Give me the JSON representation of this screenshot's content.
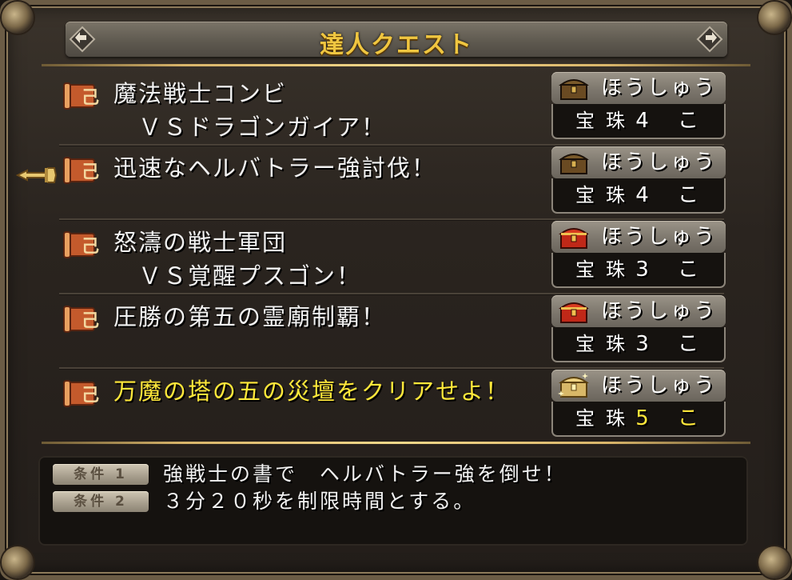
{
  "header": {
    "title": "達人クエスト"
  },
  "quests": [
    {
      "name": "魔法戦士コンビ\n　ＶＳドラゴンガイア！",
      "reward_label": "ほうしゅう",
      "reward_item": "宝珠",
      "reward_count": "4 こ",
      "chest": "wooden-chest-icon",
      "highlight": false
    },
    {
      "name": "迅速なヘルバトラー強討伐！",
      "reward_label": "ほうしゅう",
      "reward_item": "宝珠",
      "reward_count": "4 こ",
      "chest": "wooden-chest-icon",
      "highlight": false
    },
    {
      "name": "怒濤の戦士軍団\n　ＶＳ覚醒プスゴン！",
      "reward_label": "ほうしゅう",
      "reward_item": "宝珠",
      "reward_count": "3 こ",
      "chest": "red-chest-icon",
      "highlight": false
    },
    {
      "name": "圧勝の第五の霊廟制覇！",
      "reward_label": "ほうしゅう",
      "reward_item": "宝珠",
      "reward_count": "3 こ",
      "chest": "red-chest-icon",
      "highlight": false
    },
    {
      "name": "万魔の塔の五の災壇をクリアせよ！",
      "reward_label": "ほうしゅう",
      "reward_item": "宝珠",
      "reward_count": "5 こ",
      "chest": "gold-chest-icon",
      "highlight": true
    }
  ],
  "conditions": [
    {
      "tag": "条件 1",
      "text": "強戦士の書で　ヘルバトラー強を倒せ！"
    },
    {
      "tag": "条件 2",
      "text": "３分２０秒を制限時間とする。"
    }
  ],
  "colors": {
    "highlight": "#ffe83a",
    "title": "#f0c640",
    "text": "#f2f2f2"
  },
  "cursor": {
    "icon": "pointing-hand-cursor-icon",
    "selected_index": 1
  }
}
